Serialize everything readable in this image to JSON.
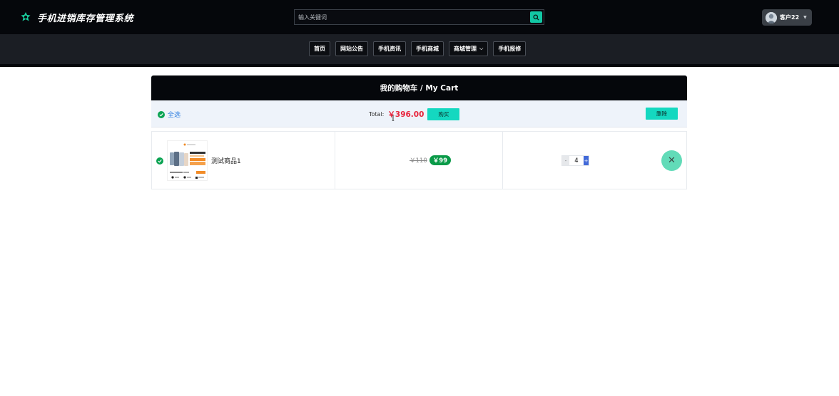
{
  "header": {
    "app_title": "手机进销库存管理系统",
    "search": {
      "placeholder": "输入关键词"
    },
    "user": {
      "name": "客户22"
    }
  },
  "nav": {
    "items": [
      {
        "label": "首页"
      },
      {
        "label": "网站公告"
      },
      {
        "label": "手机资讯"
      },
      {
        "label": "手机商城"
      },
      {
        "label": "商城管理",
        "has_dropdown": true
      },
      {
        "label": "手机报修"
      }
    ]
  },
  "cart": {
    "heading": "我的购物车 / My Cart",
    "select_all_label": "全选",
    "total_label": "Total:",
    "total_amount": "￥396.00",
    "buy_label": "购买",
    "delete_label": "删除",
    "items": [
      {
        "name": "测试商品1",
        "original_price": "￥110",
        "price": "￥99",
        "quantity": "4",
        "minus_label": "-",
        "plus_label": "+",
        "selected": true
      }
    ]
  },
  "colors": {
    "header_bg": "#05070b",
    "nav_bg": "#1b1e24",
    "accent_teal": "#14d8c0",
    "price_red": "#e8263d",
    "check_green": "#0aa352",
    "link_blue": "#2f7fe0"
  },
  "icons": {
    "brand": "leaf-logo-icon",
    "search": "search-icon",
    "check": "check-circle-icon",
    "remove": "close-icon",
    "dropdown": "chevron-down-icon"
  }
}
